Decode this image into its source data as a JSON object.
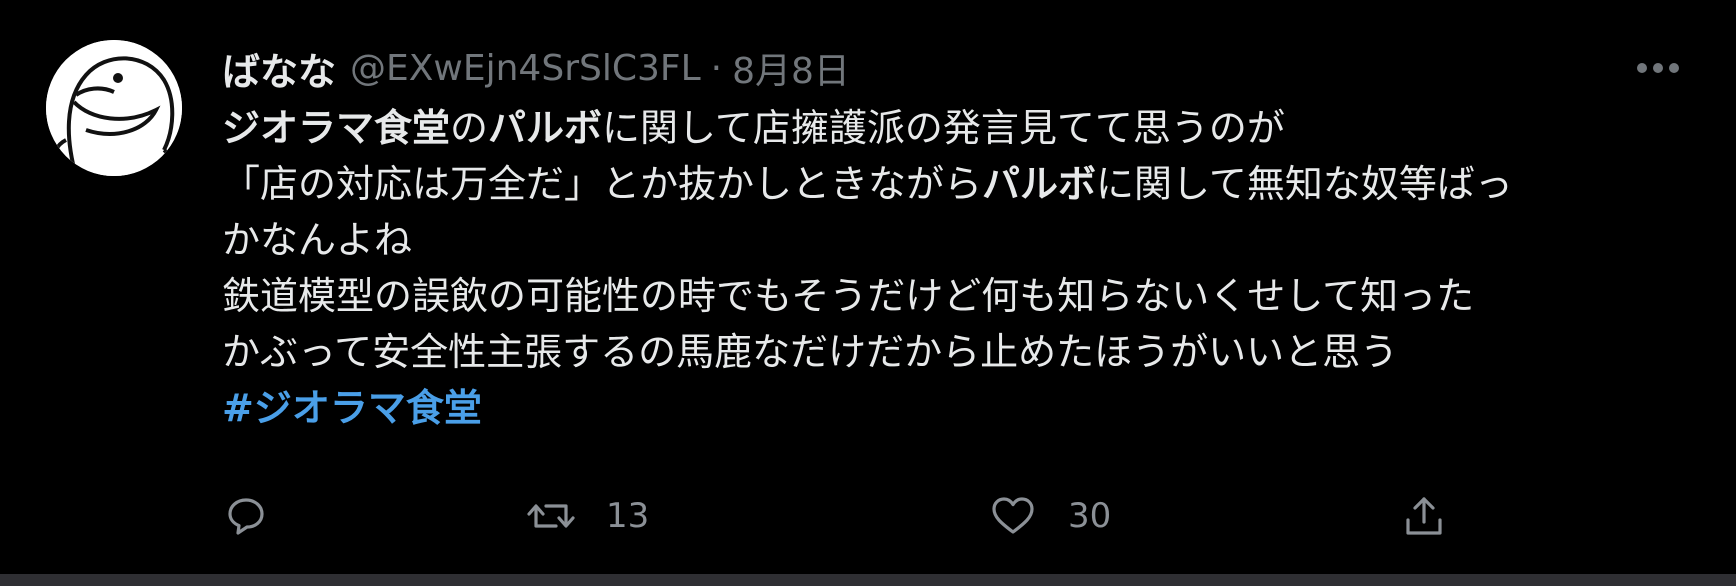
{
  "tweet": {
    "display_name": "ばなな",
    "handle": "@EXwEjn4SrSlC3FL",
    "separator": "·",
    "date": "8月8日",
    "body": {
      "l1_a": "ジオラマ食堂",
      "l1_b": "の",
      "l1_c": "パルボ",
      "l1_d": "に関して店擁護派の発言見てて思うのが",
      "l2_a": "「店の対応は万全だ」とか抜かしときながら",
      "l2_b": "パルボ",
      "l2_c": "に関して無知な奴等ばっ",
      "l3": "かなんよね",
      "l4": "鉄道模型の誤飲の可能性の時でもそうだけど何も知らないくせして知った",
      "l5": "かぶって安全性主張するの馬鹿なだけだから止めたほうがいいと思う",
      "hashtag": "#ジオラマ食堂"
    }
  },
  "actions": {
    "reply_icon": "reply-icon",
    "retweet_icon": "retweet-icon",
    "retweet_count": "13",
    "like_icon": "heart-icon",
    "like_count": "30",
    "share_icon": "share-icon",
    "more_icon": "more-dots-icon"
  },
  "colors": {
    "background": "#000000",
    "text": "#e7e9ea",
    "muted": "#71767b",
    "hashtag": "#4a9fe8"
  }
}
